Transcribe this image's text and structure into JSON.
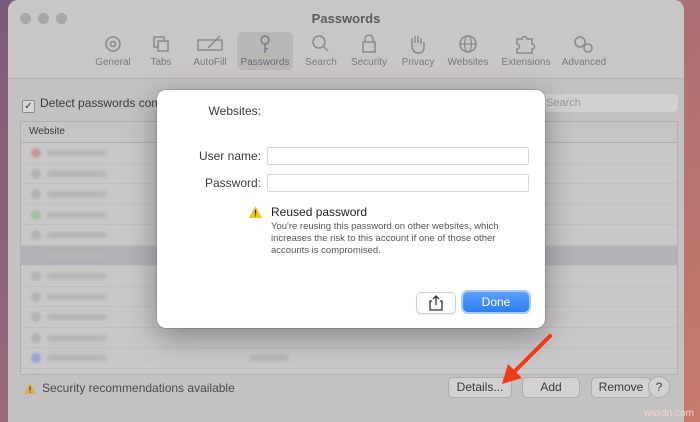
{
  "window": {
    "title": "Passwords"
  },
  "toolbar": {
    "tabs": [
      {
        "label": "General",
        "icon": "gear-icon"
      },
      {
        "label": "Tabs",
        "icon": "tabs-icon"
      },
      {
        "label": "AutoFill",
        "icon": "pen-icon"
      },
      {
        "label": "Passwords",
        "icon": "key-icon",
        "active": true
      },
      {
        "label": "Search",
        "icon": "magnifier-icon"
      },
      {
        "label": "Security",
        "icon": "lock-icon"
      },
      {
        "label": "Privacy",
        "icon": "hand-icon"
      },
      {
        "label": "Websites",
        "icon": "globe-icon"
      },
      {
        "label": "Extensions",
        "icon": "puzzle-icon"
      },
      {
        "label": "Advanced",
        "icon": "gears-icon"
      }
    ]
  },
  "main": {
    "detect_label": "Detect passwords com",
    "search_placeholder": "Search",
    "table": {
      "column_website": "Website"
    }
  },
  "footer": {
    "warning_text": "Security recommendations available",
    "details_label": "Details...",
    "add_label": "Add",
    "remove_label": "Remove",
    "help_label": "?"
  },
  "sheet": {
    "websites_label": "Websites:",
    "username_label": "User name:",
    "password_label": "Password:",
    "reused_title": "Reused password",
    "reused_body": "You're reusing this password on other websites, which increases the risk to this account if one of those other accounts is compromised.",
    "done_label": "Done"
  },
  "watermark": "wsxdn.com",
  "colors": {
    "accent": "#2c7ef0",
    "warning": "#f5c518",
    "arrow": "#f03a17"
  }
}
